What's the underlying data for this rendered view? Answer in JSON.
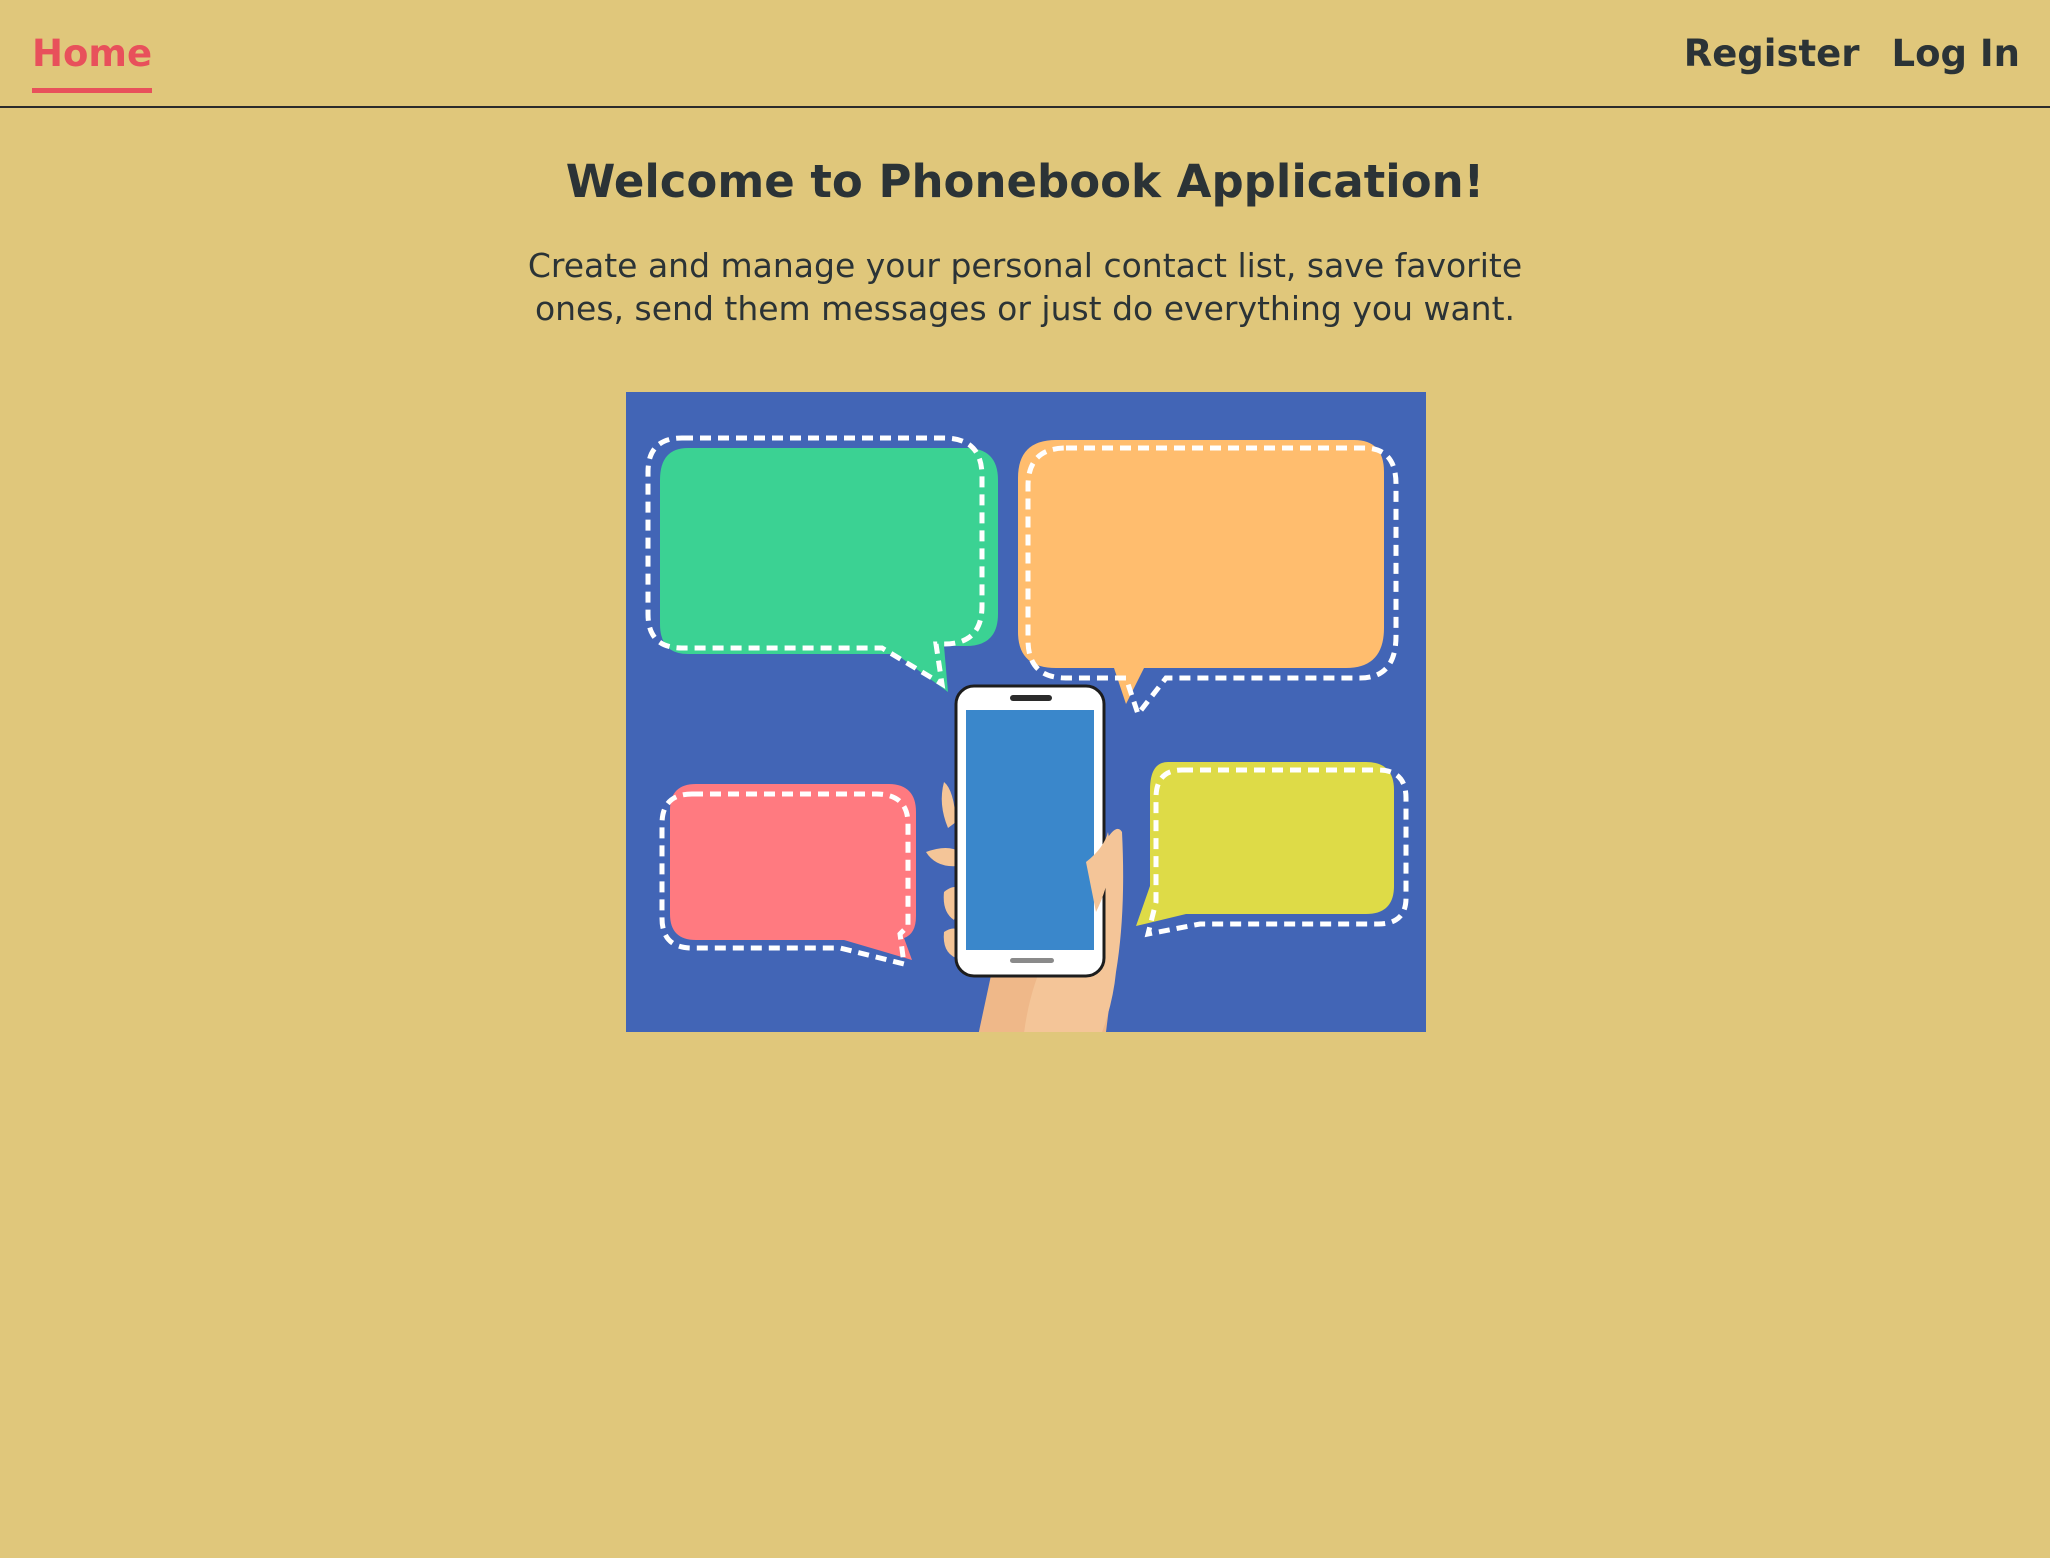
{
  "nav": {
    "home_label": "Home",
    "register_label": "Register",
    "login_label": "Log In"
  },
  "main": {
    "title": "Welcome to Phonebook Application!",
    "subtitle": "Create and manage your personal contact list, save favorite ones, send them messages or just do everything you want."
  },
  "colors": {
    "page_background": "#e0c77b",
    "accent": "#e8505b",
    "text": "#2b3336",
    "illustration_background": "#4265b6",
    "bubble_green": "#3bd293",
    "bubble_orange": "#ffbd6e",
    "bubble_pink": "#ff7a80",
    "bubble_yellow": "#dedb47",
    "phone_screen": "#3a87cb"
  },
  "illustration": {
    "icon": "phone-with-chat-bubbles-illustration"
  }
}
